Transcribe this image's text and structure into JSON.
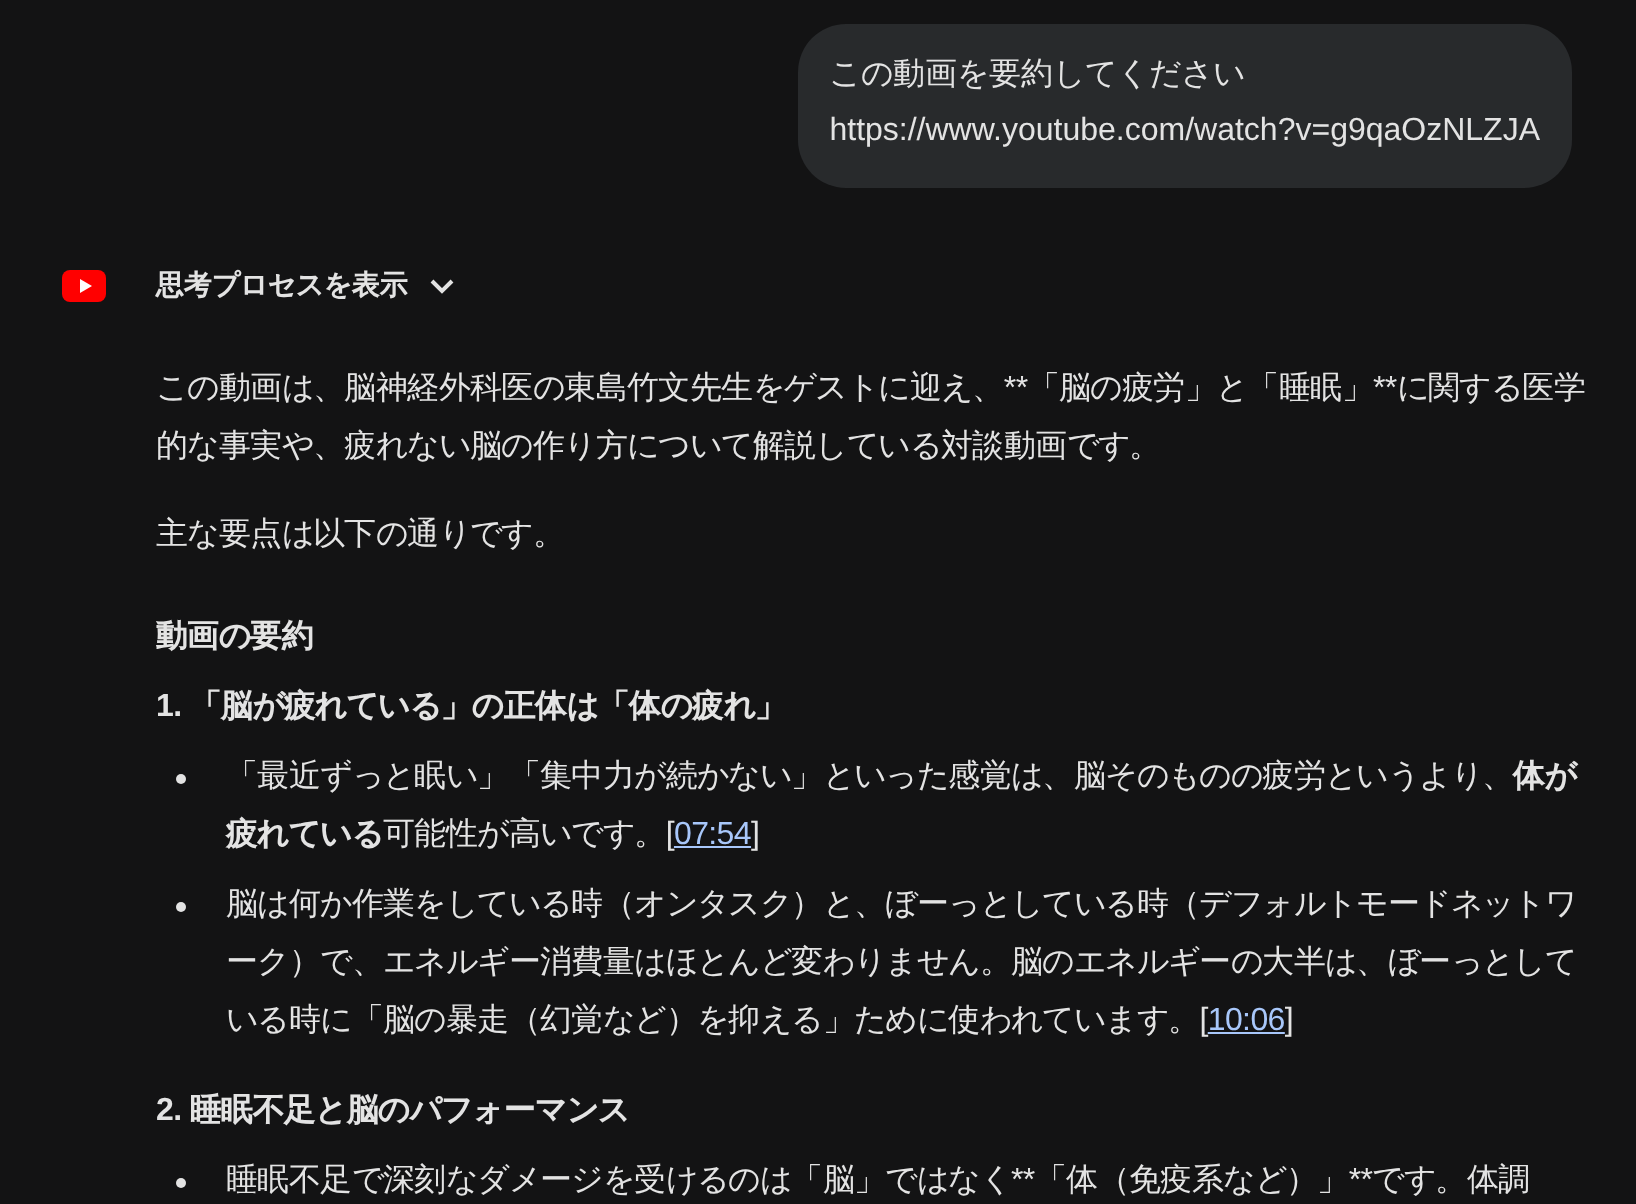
{
  "user_message": {
    "lines": [
      "この動画を要約してください",
      "https://www.youtube.com/watch?v=g9qaOzNLZJA"
    ]
  },
  "thinking_toggle": {
    "label": "思考プロセスを表示",
    "expanded": false
  },
  "response": {
    "intro": "この動画は、脳神経外科医の東島竹文先生をゲストに迎え、**「脳の疲労」と「睡眠」**に関する医学的な事実や、疲れない脳の作り方について解説している対談動画です。",
    "lead": "主な要点は以下の通りです。",
    "heading": "動画の要約",
    "sections": [
      {
        "title": "1. 「脳が疲れている」の正体は「体の疲れ」",
        "bullets": [
          {
            "kind": "rich",
            "text": "「最近ずっと眠い」「集中力が続かない」といった感覚は、脳そのものの疲労というより、**体が疲れている**可能性が高いです。[",
            "link": "07:54",
            "after": "]"
          },
          {
            "kind": "rich",
            "text": "脳は何か作業をしている時（オンタスク）と、ぼーっとしている時（デフォルトモードネットワーク）で、エネルギー消費量はほとんど変わりません。脳のエネルギーの大半は、ぼーっとしている時に「脳の暴走（幻覚など）を抑える」ために使われています。[",
            "link": "10:06",
            "after": "]"
          }
        ]
      },
      {
        "title": "2. 睡眠不足と脳のパフォーマンス",
        "bullets": [
          {
            "kind": "plain",
            "text": "睡眠不足で深刻なダメージを受けるのは「脳」ではなく**「体（免疫系など）」**です。体調"
          }
        ]
      }
    ]
  }
}
